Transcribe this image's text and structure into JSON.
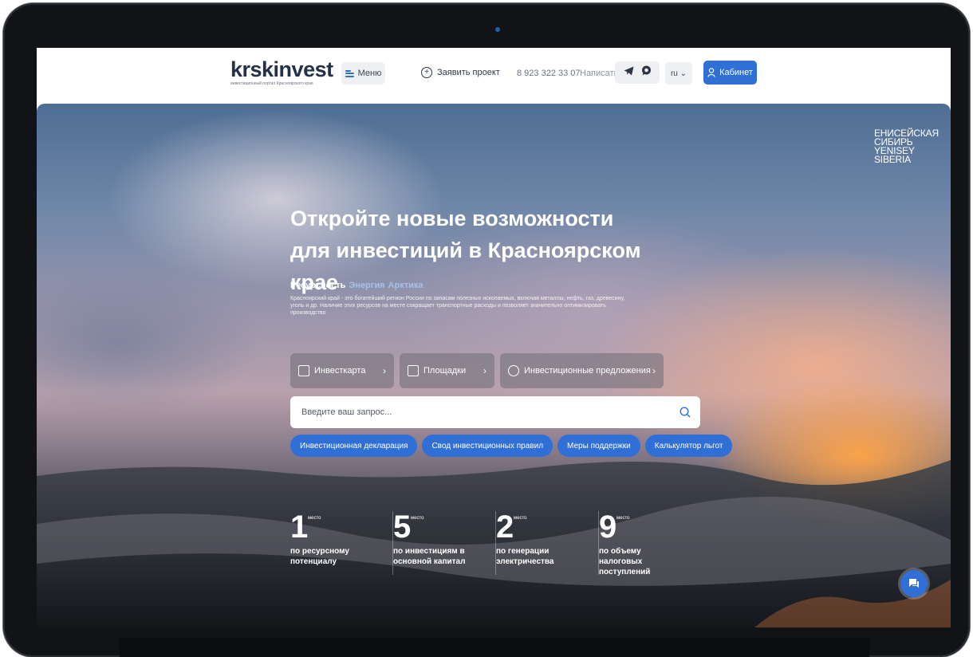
{
  "header": {
    "logo": "krskinvest",
    "logo_sub": "инвестиционный портал Красноярского края",
    "menu_label": "Меню",
    "submit_project": "Заявить проект",
    "phone": "8 923 322 33 07",
    "write_label": "Написать",
    "lang": "ru ⌄",
    "cabinet": "Кабинет"
  },
  "region_logo": {
    "line1": "ЕНИСЕЙСКАЯ",
    "line2": "СИБИРЬ",
    "line3": "YENISEY",
    "line4": "SIBERIA"
  },
  "hero": {
    "title": "Откройте новые возможности для инвестиций в Красноярском крае",
    "tabs": [
      "Ресурсность",
      "Энергия",
      "Арктика"
    ],
    "description": "Красноярский край - это богатейший регион России по запасам полезных ископаемых, включая металлы, нефть, газ, древесину, уголь и др. Наличие этих ресурсов на месте сокращает транспортные расходы и позволяет значительно оптимизировать производство"
  },
  "quick_links": [
    {
      "label": "Инвесткарта",
      "icon": "map-icon"
    },
    {
      "label": "Площадки",
      "icon": "building-icon"
    },
    {
      "label": "Инвестиционные предложения",
      "icon": "database-icon"
    }
  ],
  "search": {
    "placeholder": "Введите ваш запрос..."
  },
  "pills": [
    "Инвестиционная декларация",
    "Свод инвестиционных правил",
    "Меры поддержки",
    "Калькулятор льгот"
  ],
  "stats": [
    {
      "num": "1",
      "unit": "место",
      "label": "по ресурсному потенциалу"
    },
    {
      "num": "5",
      "unit": "место",
      "label": "по инвестициям в основной капитал"
    },
    {
      "num": "2",
      "unit": "место",
      "label": "по генерации электричества"
    },
    {
      "num": "9",
      "unit": "место",
      "label": "по объему налоговых поступлений"
    }
  ],
  "colors": {
    "accent": "#2f6fd6",
    "logo": "#233249"
  }
}
